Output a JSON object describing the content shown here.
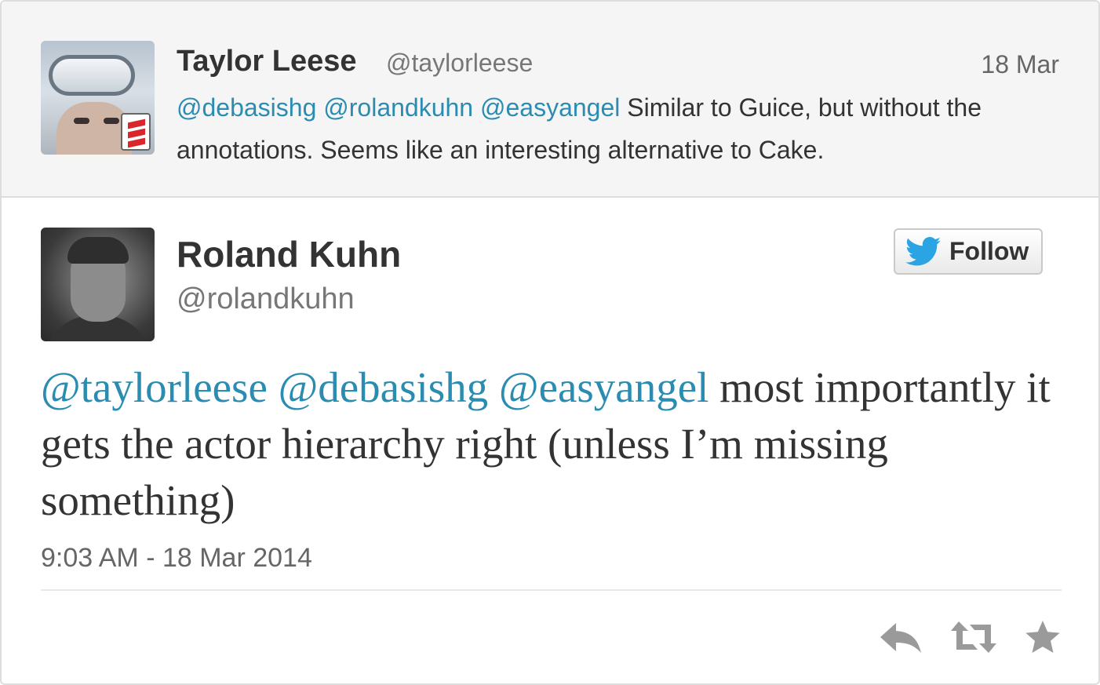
{
  "parent_tweet": {
    "author_name": "Taylor Leese",
    "author_handle": "@taylorleese",
    "date": "18 Mar",
    "mentions": [
      "@debasishg",
      "@rolandkuhn",
      "@easyangel"
    ],
    "text": "Similar to Guice, but without the annotations. Seems like an interesting alternative to Cake."
  },
  "tweet": {
    "author_name": "Roland Kuhn",
    "author_handle": "@rolandkuhn",
    "follow_label": "Follow",
    "mentions": [
      "@taylorleese",
      "@debasishg",
      "@easyangel"
    ],
    "text": "most importantly it gets the actor hierarchy right (unless I’m missing something)",
    "timestamp": "9:03 AM - 18 Mar 2014"
  },
  "actions": [
    "reply-icon",
    "retweet-icon",
    "favorite-icon"
  ],
  "colors": {
    "link": "#2b8cb2",
    "twitter_blue": "#2aa4e3",
    "icon_gray": "#9a9a9a"
  }
}
